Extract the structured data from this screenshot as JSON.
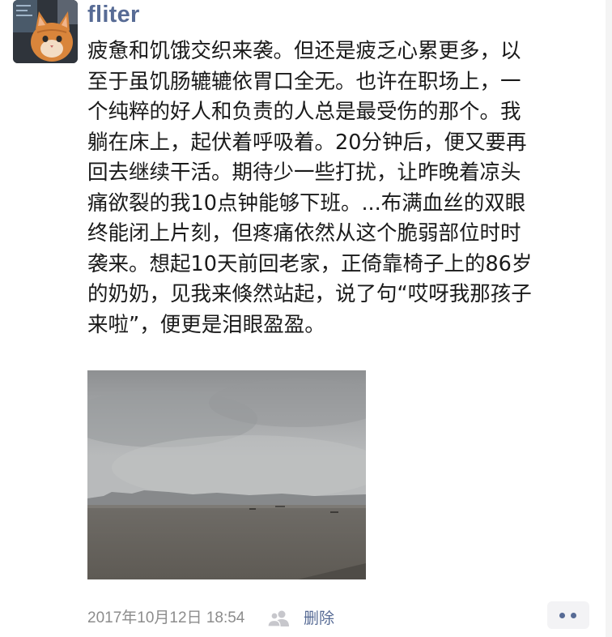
{
  "post": {
    "username": "fliter",
    "text_lines": [
      "疲惫和饥饿交织来袭。但还是疲乏心累更多，以",
      "至于虽饥肠辘辘依胃口全无。也许在职场上，一",
      "个纯粹的好人和负责的人总是最受伤的那个。我",
      "躺在床上，起伏着呼吸着。20分钟后，便又要再",
      "回去继续干活。期待少一些打扰，让昨晚着凉头",
      "痛欲裂的我10点钟能够下班。...布满血丝的双眼",
      "终能闭上片刻，但疼痛依然从这个脆弱部位时时",
      "袭来。想起10天前回老家，正倚靠椅子上的86岁",
      "的奶奶，见我来倏然站起，说了句“哎呀我那孩子",
      "来啦”，便更是泪眼盈盈。"
    ]
  },
  "footer": {
    "timestamp": "2017年10月12日 18:54",
    "delete_label": "删除"
  },
  "icons": {
    "avatar": "cat-avatar",
    "privacy": "friends-visibility-icon",
    "more": "more-dots-icon"
  },
  "colors": {
    "username": "#576b95",
    "link": "#576b95",
    "text": "#1a1a1a",
    "meta": "#8c8c8c"
  }
}
